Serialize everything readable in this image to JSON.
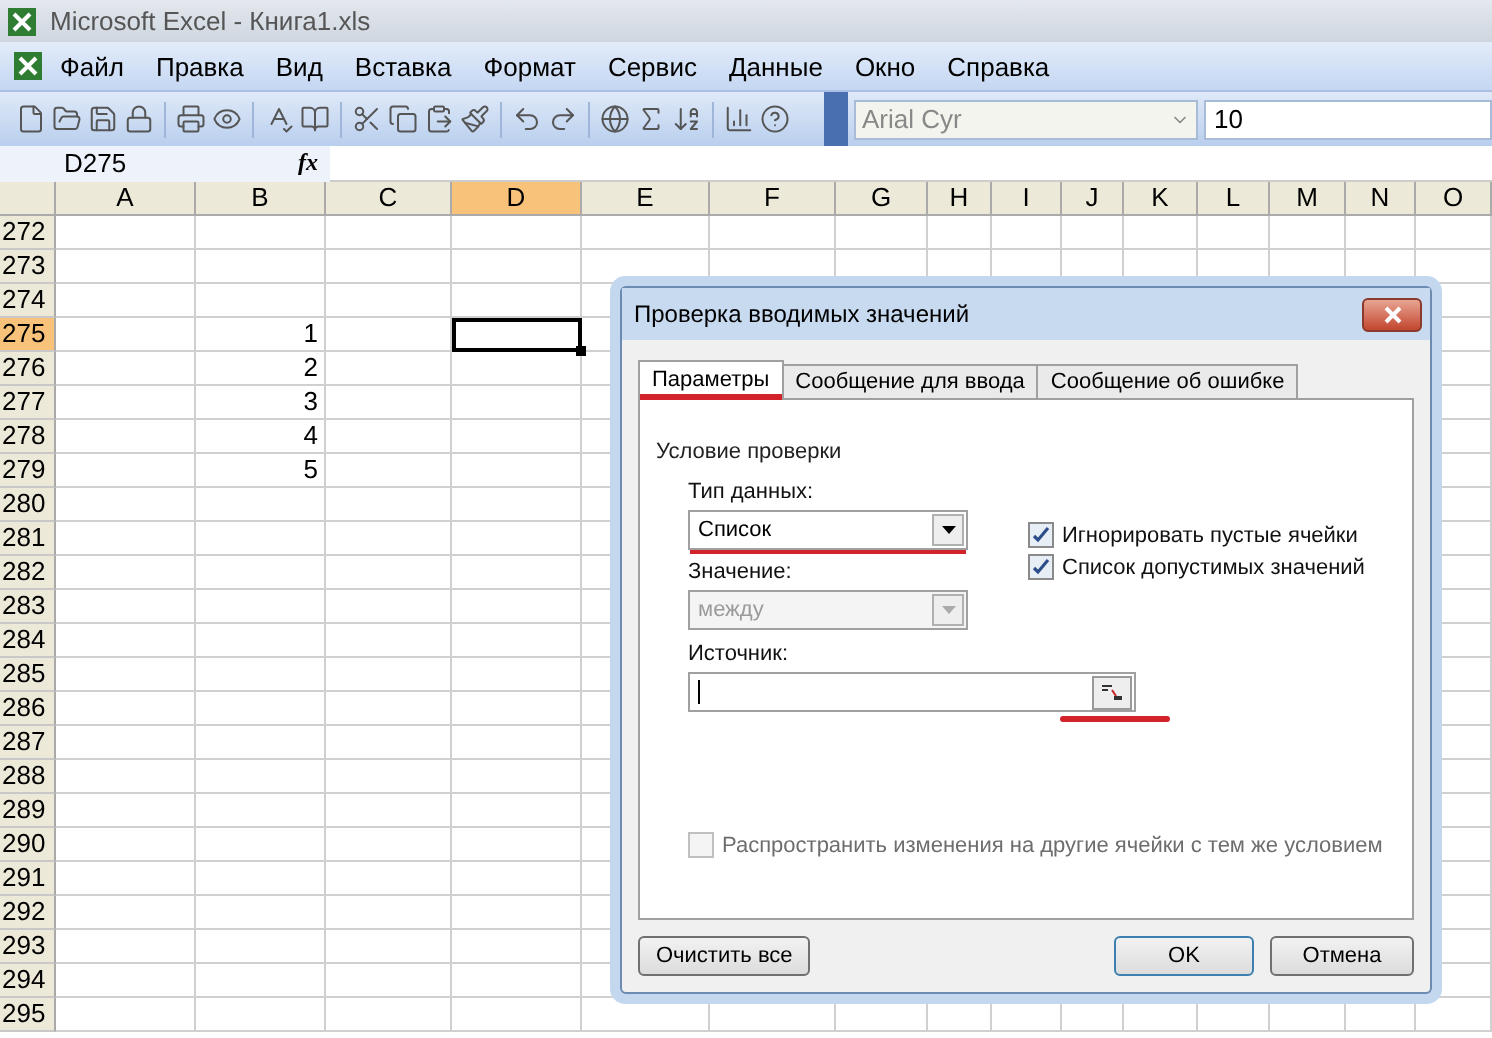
{
  "window": {
    "title": "Microsoft Excel - Книга1.xls"
  },
  "menu": [
    "Файл",
    "Правка",
    "Вид",
    "Вставка",
    "Формат",
    "Сервис",
    "Данные",
    "Окно",
    "Справка"
  ],
  "toolbar": {
    "font": "Arial Cyr",
    "size": "10"
  },
  "formula_bar": {
    "name_box": "D275",
    "function_label": "fx"
  },
  "grid": {
    "columns": [
      {
        "label": "A",
        "selected": false
      },
      {
        "label": "B",
        "selected": false
      },
      {
        "label": "C",
        "selected": false
      },
      {
        "label": "D",
        "selected": true
      },
      {
        "label": "E",
        "selected": false
      },
      {
        "label": "F",
        "selected": false
      },
      {
        "label": "G",
        "selected": false
      },
      {
        "label": "H",
        "selected": false
      },
      {
        "label": "I",
        "selected": false
      },
      {
        "label": "J",
        "selected": false
      },
      {
        "label": "K",
        "selected": false
      },
      {
        "label": "L",
        "selected": false
      },
      {
        "label": "M",
        "selected": false
      },
      {
        "label": "N",
        "selected": false
      },
      {
        "label": "O",
        "selected": false
      }
    ],
    "rows": [
      {
        "label": "272",
        "selected": false
      },
      {
        "label": "273",
        "selected": false
      },
      {
        "label": "274",
        "selected": false
      },
      {
        "label": "275",
        "selected": true,
        "column_b": "1"
      },
      {
        "label": "276",
        "selected": false,
        "column_b": "2"
      },
      {
        "label": "277",
        "selected": false,
        "column_b": "3"
      },
      {
        "label": "278",
        "selected": false,
        "column_b": "4"
      },
      {
        "label": "279",
        "selected": false,
        "column_b": "5"
      },
      {
        "label": "280",
        "selected": false
      },
      {
        "label": "281",
        "selected": false
      },
      {
        "label": "282",
        "selected": false
      },
      {
        "label": "283",
        "selected": false
      },
      {
        "label": "284",
        "selected": false
      },
      {
        "label": "285",
        "selected": false
      },
      {
        "label": "286",
        "selected": false
      },
      {
        "label": "287",
        "selected": false
      },
      {
        "label": "288",
        "selected": false
      },
      {
        "label": "289",
        "selected": false
      },
      {
        "label": "290",
        "selected": false
      },
      {
        "label": "291",
        "selected": false
      },
      {
        "label": "292",
        "selected": false
      },
      {
        "label": "293",
        "selected": false
      },
      {
        "label": "294",
        "selected": false
      },
      {
        "label": "295",
        "selected": false
      }
    ]
  },
  "dialog": {
    "title": "Проверка вводимых значений",
    "tabs": [
      {
        "label": "Параметры",
        "selected": true,
        "underlined": true
      },
      {
        "label": "Сообщение для ввода",
        "selected": false,
        "underlined": false
      },
      {
        "label": "Сообщение об ошибке",
        "selected": false,
        "underlined": false
      }
    ],
    "group_title": "Условие проверки",
    "data_type": {
      "label": "Тип данных:",
      "value": "Список",
      "underlined": true
    },
    "checkboxes": [
      {
        "label": "Игнорировать пустые ячейки",
        "checked": true
      },
      {
        "label": "Список допустимых значений",
        "checked": true
      }
    ],
    "comparison": {
      "label": "Значение:",
      "value": "между",
      "disabled": true
    },
    "source": {
      "label": "Источник:",
      "underlined": true
    },
    "apply_all": {
      "label": "Распространить изменения на другие ячейки с тем же условием",
      "checked": false,
      "disabled": true
    },
    "buttons": {
      "clear": "Очистить все",
      "ok": "OK",
      "cancel": "Отмена"
    }
  }
}
